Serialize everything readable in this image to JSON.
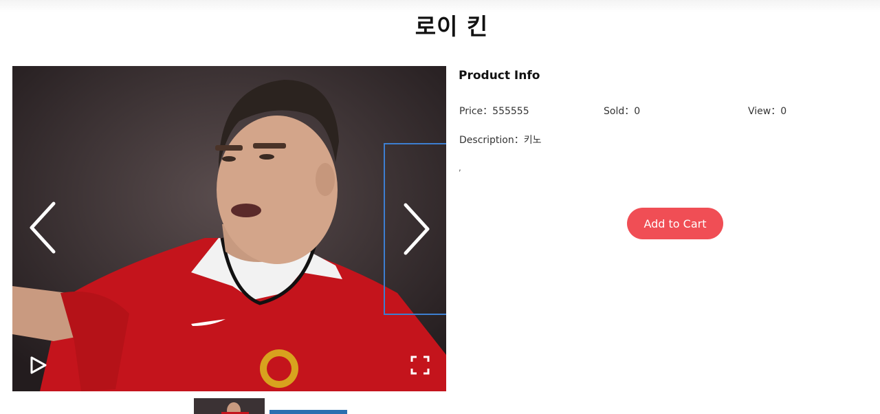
{
  "page": {
    "title": "로이 킨"
  },
  "gallery": {
    "prev_icon": "chevron-left-icon",
    "next_icon": "chevron-right-icon",
    "play_icon": "play-icon",
    "fullscreen_icon": "fullscreen-icon",
    "thumbnail_count": 2
  },
  "product_info": {
    "heading": "Product Info",
    "price_label": "Price：",
    "price_value": "555555",
    "sold_label": "Sold：",
    "sold_value": "0",
    "view_label": "View：",
    "view_value": "0",
    "description_label": "Description：",
    "description_value": "키노",
    "extra_text": ","
  },
  "actions": {
    "add_to_cart_label": "Add to Cart",
    "accent_color": "#f04e55"
  }
}
